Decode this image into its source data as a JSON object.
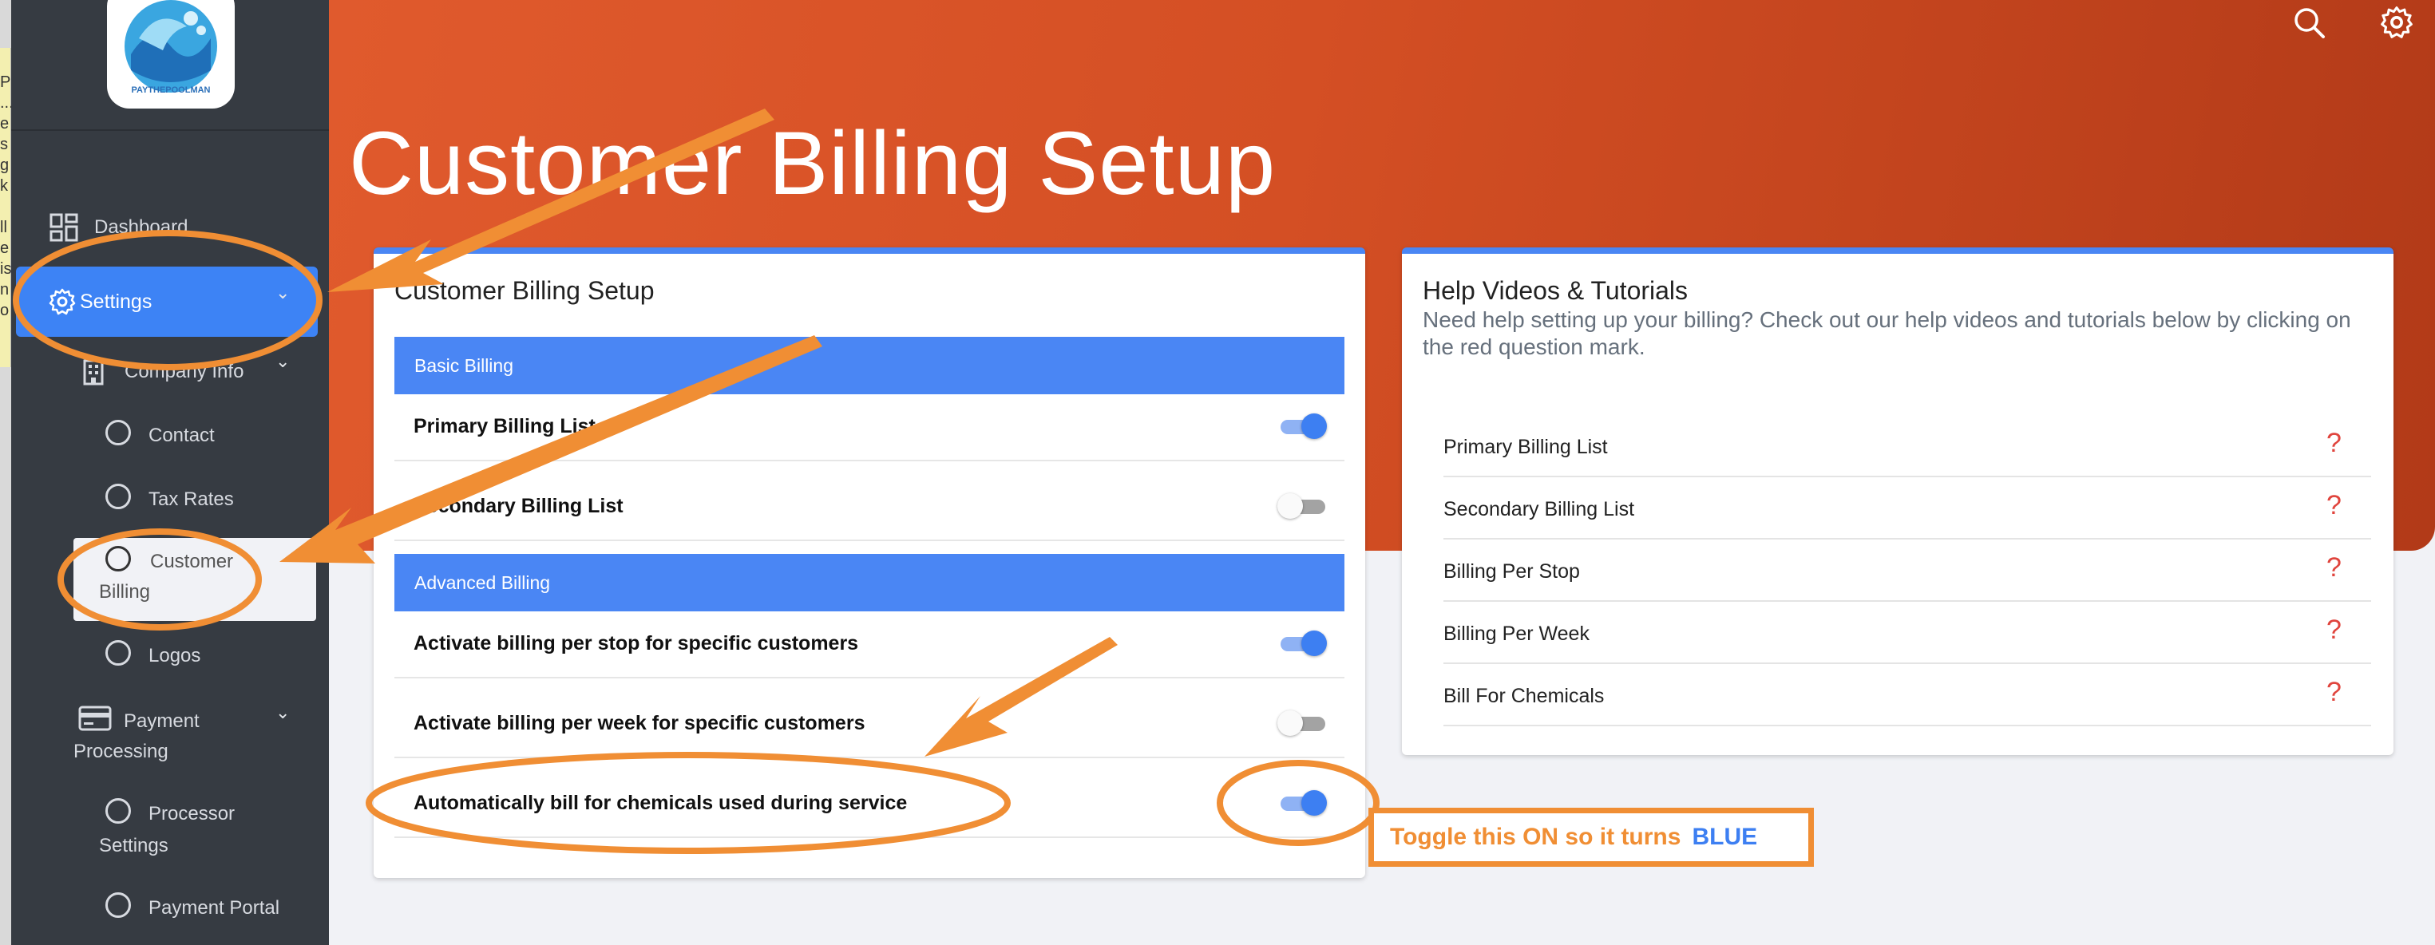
{
  "sidebar": {
    "edge_text": "P\n...\ne\ns\ng\nk\n\nll\ne\nis\nn\no",
    "nav": {
      "dashboard": "Dashboard",
      "settings": "Settings",
      "company_info": "Company Info",
      "contact": "Contact",
      "tax_rates": "Tax Rates",
      "customer_billing_1": "Customer",
      "customer_billing_2": "Billing",
      "logos": "Logos",
      "payment_processing_1": "Payment",
      "payment_processing_2": "Processing",
      "processor_settings_1": "Processor",
      "processor_settings_2": "Settings",
      "payment_portal": "Payment Portal"
    },
    "logo_text": "PAYTHEPOOLMAN"
  },
  "header": {
    "title": "Customer Billing Setup"
  },
  "setup_card": {
    "title": "Customer Billing Setup",
    "basic_section": "Basic Billing",
    "basic_rows": [
      {
        "label": "Primary Billing List",
        "on": true
      },
      {
        "label": "Secondary Billing List",
        "on": false
      }
    ],
    "advanced_section": "Advanced Billing",
    "advanced_rows": [
      {
        "label": "Activate billing per stop for specific customers",
        "on": true
      },
      {
        "label": "Activate billing per week for specific customers",
        "on": false
      },
      {
        "label": "Automatically bill for chemicals used during service",
        "on": true
      }
    ]
  },
  "help_card": {
    "title": "Help Videos & Tutorials",
    "description": "Need help setting up your billing? Check out our help videos and tutorials below by clicking on the red question mark.",
    "items": [
      {
        "label": "Primary Billing List",
        "icon": "?"
      },
      {
        "label": "Secondary Billing List",
        "icon": "?"
      },
      {
        "label": "Billing Per Stop",
        "icon": "?"
      },
      {
        "label": "Billing Per Week",
        "icon": "?"
      },
      {
        "label": "Bill For Chemicals",
        "icon": "?"
      }
    ]
  },
  "annotation": {
    "note_text": "Toggle this ON so it turns",
    "note_highlight": "BLUE",
    "color_orange": "#f08e34",
    "color_blue": "#3d7ff2"
  },
  "colors": {
    "banner": "#d44f24",
    "sidebar": "#363b42",
    "accent": "#4a86f4",
    "question": "#e0443d"
  }
}
